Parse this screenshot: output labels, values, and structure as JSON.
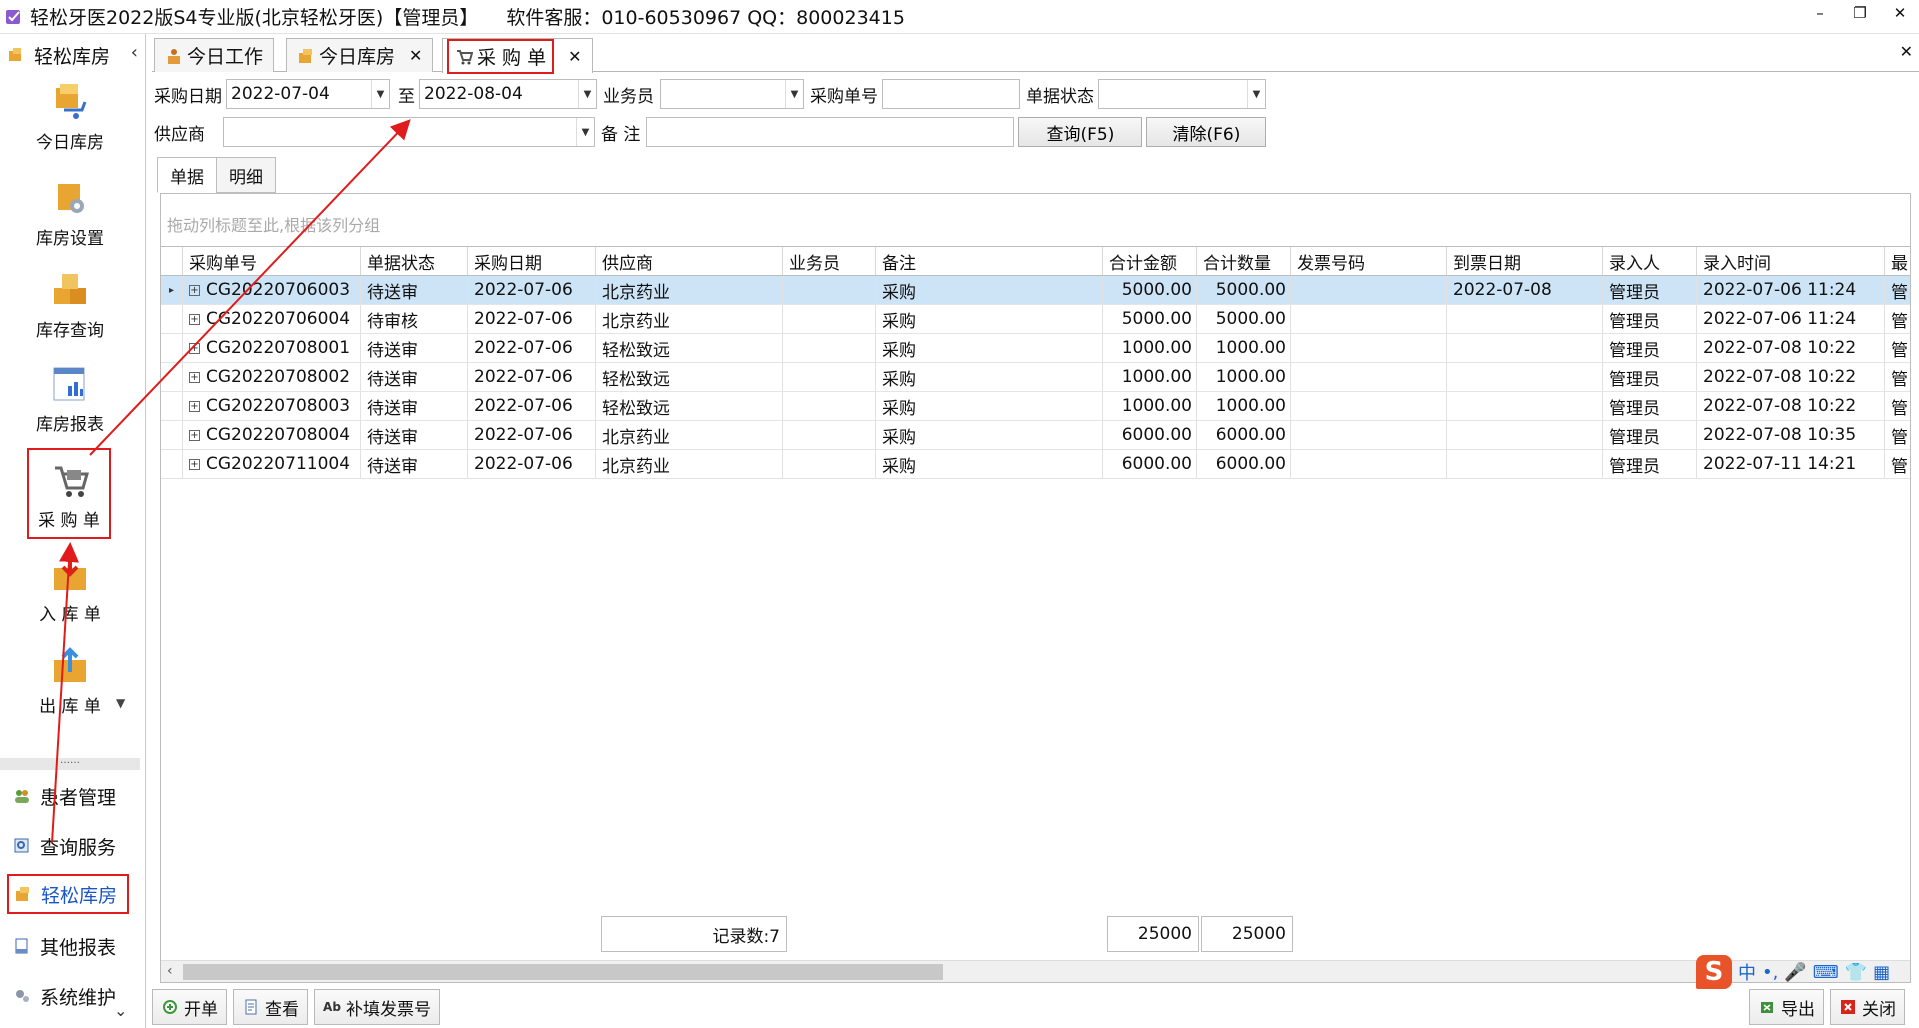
{
  "app": {
    "title": "轻松牙医2022版S4专业版(北京轻松牙医)【管理员】",
    "support": "软件客服：010-60530967 QQ：800023415"
  },
  "sidebar": {
    "header": "轻松库房",
    "items": [
      {
        "label": "今日库房",
        "icon": "cart-box-icon"
      },
      {
        "label": "库房设置",
        "icon": "gear-box-icon"
      },
      {
        "label": "库存查询",
        "icon": "boxes-icon"
      },
      {
        "label": "库房报表",
        "icon": "report-chart-icon"
      },
      {
        "label": "采 购 单",
        "icon": "shopping-cart-icon"
      },
      {
        "label": "入 库 单",
        "icon": "box-in-icon"
      },
      {
        "label": "出 库 单",
        "icon": "box-out-icon"
      }
    ],
    "splitter": "……",
    "nav": [
      {
        "label": "患者管理",
        "icon": "patients-icon"
      },
      {
        "label": "查询服务",
        "icon": "search-service-icon"
      },
      {
        "label": "轻松库房",
        "icon": "warehouse-icon"
      },
      {
        "label": "其他报表",
        "icon": "other-report-icon"
      },
      {
        "label": "系统维护",
        "icon": "system-gears-icon"
      }
    ]
  },
  "tabs": [
    {
      "label": "今日工作",
      "icon": "worker-icon"
    },
    {
      "label": "今日库房",
      "icon": "box-icon"
    },
    {
      "label": "采 购 单",
      "icon": "cart-icon"
    }
  ],
  "filters": {
    "date_label": "采购日期",
    "date_from": "2022-07-04",
    "to_label": "至",
    "date_to": "2022-08-04",
    "staff_label": "业务员",
    "staff_value": "",
    "order_no_label": "采购单号",
    "order_no_value": "",
    "status_label": "单据状态",
    "status_value": "",
    "supplier_label": "供应商",
    "supplier_value": "",
    "remark_label": "备  注",
    "remark_value": "",
    "query_button": "查询(F5)",
    "clear_button": "清除(F6)"
  },
  "subtabs": [
    "单据",
    "明细"
  ],
  "grid": {
    "group_hint": "拖动列标题至此,根据该列分组",
    "columns": [
      "采购单号",
      "单据状态",
      "采购日期",
      "供应商",
      "业务员",
      "备注",
      "合计金额",
      "合计数量",
      "发票号码",
      "到票日期",
      "录入人",
      "录入时间",
      "最"
    ],
    "rows": [
      [
        "CG20220706003",
        "待送审",
        "2022-07-06",
        "北京药业",
        "",
        "采购",
        "5000.00",
        "5000.00",
        "",
        "2022-07-08",
        "管理员",
        "2022-07-06 11:24",
        "管"
      ],
      [
        "CG20220706004",
        "待审核",
        "2022-07-06",
        "北京药业",
        "",
        "采购",
        "5000.00",
        "5000.00",
        "",
        "",
        "管理员",
        "2022-07-06 11:24",
        "管"
      ],
      [
        "CG20220708001",
        "待送审",
        "2022-07-06",
        "轻松致远",
        "",
        "采购",
        "1000.00",
        "1000.00",
        "",
        "",
        "管理员",
        "2022-07-08 10:22",
        "管"
      ],
      [
        "CG20220708002",
        "待送审",
        "2022-07-06",
        "轻松致远",
        "",
        "采购",
        "1000.00",
        "1000.00",
        "",
        "",
        "管理员",
        "2022-07-08 10:22",
        "管"
      ],
      [
        "CG20220708003",
        "待送审",
        "2022-07-06",
        "轻松致远",
        "",
        "采购",
        "1000.00",
        "1000.00",
        "",
        "",
        "管理员",
        "2022-07-08 10:22",
        "管"
      ],
      [
        "CG20220708004",
        "待送审",
        "2022-07-06",
        "北京药业",
        "",
        "采购",
        "6000.00",
        "6000.00",
        "",
        "",
        "管理员",
        "2022-07-08 10:35",
        "管"
      ],
      [
        "CG20220711004",
        "待送审",
        "2022-07-06",
        "北京药业",
        "",
        "采购",
        "6000.00",
        "6000.00",
        "",
        "",
        "管理员",
        "2022-07-11 14:21",
        "管"
      ]
    ],
    "footer": {
      "record_count": "记录数:7",
      "total_amount": "25000",
      "total_qty": "25000"
    }
  },
  "toolbar": {
    "new_label": "开单",
    "view_label": "查看",
    "invoice_label": "补填发票号",
    "export_label": "导出",
    "close_label": "关闭"
  },
  "ime": {
    "mode": "中",
    "punct": "•,"
  },
  "colors": {
    "accent_red": "#e01b1b",
    "selected_row": "#cde4f7",
    "active_nav_text": "#1a56c8"
  }
}
